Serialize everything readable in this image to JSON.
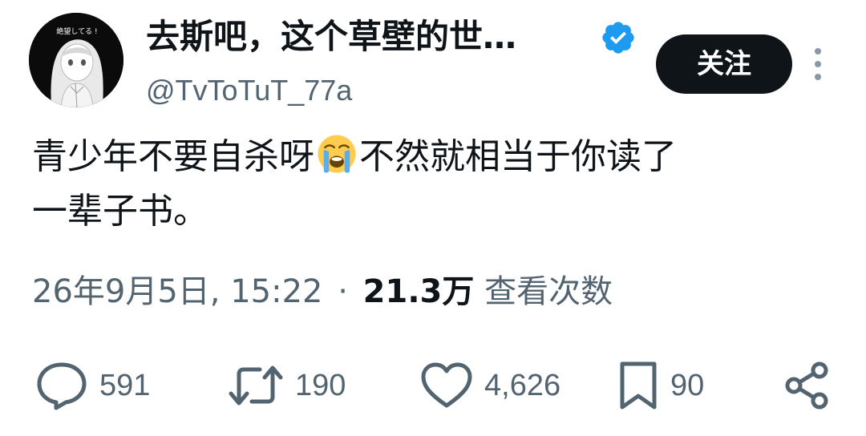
{
  "user": {
    "display_name": "去斯吧，这个草壁的世…",
    "handle": "@TvToTuT_77a",
    "avatar_text": "絶望してる !",
    "verified_icon": "verified-badge-icon"
  },
  "header": {
    "follow_label": "关注",
    "more_icon": "more-vertical-icon"
  },
  "tweet": {
    "text_part1": "青少年不要自杀呀",
    "emoji": "loudly-crying-face",
    "text_part2": "不然就相当于你读了",
    "text_line2": "一辈子书。"
  },
  "meta": {
    "timestamp": "26年9月5日, 15:22",
    "separator": "·",
    "views_count": "21.3万",
    "views_label": "查看次数"
  },
  "actions": {
    "reply_count": "591",
    "retweet_count": "190",
    "like_count": "4,626",
    "bookmark_count": "90"
  },
  "colors": {
    "text": "#0f1419",
    "secondary": "#536471",
    "verified": "#1d9bf0",
    "button_bg": "#0f1419"
  }
}
